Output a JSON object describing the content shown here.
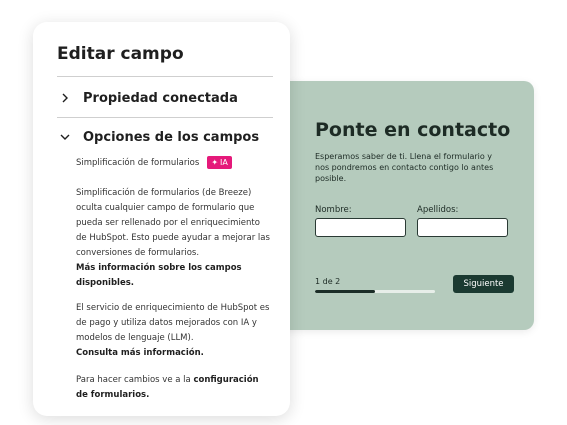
{
  "form_preview": {
    "title": "Ponte en contacto",
    "description": "Esperamos saber de ti. Llena el formulario y nos pondremos en contacto contigo lo antes posible.",
    "first_name_label": "Nombre:",
    "last_name_label": "Apellidos:",
    "step_text": "1 de 2",
    "progress": 0.5,
    "next_label": "Siguiente",
    "background_color": "#b5cbbd",
    "button_color": "#1b3a31"
  },
  "panel": {
    "title": "Editar campo",
    "sections": [
      {
        "label": "Propiedad conectada",
        "expanded": false,
        "icon": "chevron-right-icon"
      },
      {
        "label": "Opciones de los campos",
        "expanded": true,
        "icon": "chevron-down-icon"
      }
    ],
    "sub_label": "Simplificación de formularios",
    "badge": {
      "icon": "sparkle-icon",
      "text": "IA",
      "color": "#e5197a"
    },
    "paragraph1": "Simplificación de formularios (de Breeze) oculta cualquier campo de formulario que pueda ser rellenado por el enriquecimiento de HubSpot. Esto puede ayudar a mejorar las conversiones de formularios.",
    "link1": "Más información sobre los campos disponibles.",
    "paragraph2": "El servicio de enriquecimiento de HubSpot es de pago y utiliza datos mejorados con IA y modelos de lenguaje (LLM).",
    "link2": "Consulta más información.",
    "paragraph3_prefix": "Para hacer cambios ve a la",
    "link3": "configuración de formularios."
  }
}
